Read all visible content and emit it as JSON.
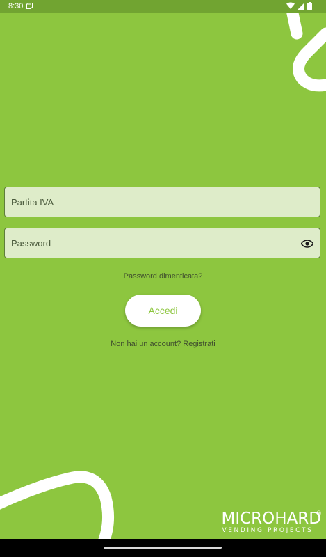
{
  "status_bar": {
    "time": "8:30"
  },
  "login": {
    "vat_placeholder": "Partita IVA",
    "password_placeholder": "Password",
    "forgot_password": "Password dimenticata?",
    "login_button": "Accedi",
    "register_prompt": "Non hai un account? Registrati"
  },
  "brand": {
    "name": "MICROHARD",
    "registered_mark": "®",
    "tagline": "VENDING PROJECTS"
  },
  "colors": {
    "background": "#8DC63F",
    "status_bar": "#71A431",
    "field_fill": "#DEECC9",
    "button_text": "#8DC63F"
  },
  "icons": {
    "password_toggle": "eye-icon",
    "status_notification": "notification-icon",
    "status_wifi": "wifi-icon",
    "status_signal": "signal-icon",
    "status_battery": "battery-icon"
  }
}
